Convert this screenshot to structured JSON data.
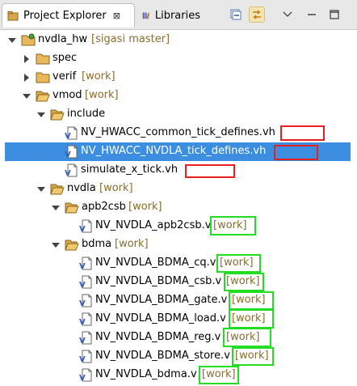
{
  "tabs": {
    "project_explorer": "Project Explorer",
    "project_explorer_close": "⊠",
    "libraries": "Libraries"
  },
  "tree": {
    "root": {
      "name": "nvdla_hw",
      "decoration": "[sigasi master]"
    },
    "spec": {
      "name": "spec"
    },
    "verif": {
      "name": "verif",
      "decoration": "[work]"
    },
    "vmod": {
      "name": "vmod",
      "decoration": "[work]"
    },
    "include": {
      "name": "include"
    },
    "include_files": [
      {
        "name": "NV_HWACC_common_tick_defines.vh"
      },
      {
        "name": "NV_HWACC_NVDLA_tick_defines.vh"
      },
      {
        "name": "simulate_x_tick.vh"
      }
    ],
    "nvdla": {
      "name": "nvdla",
      "decoration": "[work]"
    },
    "apb2csb": {
      "name": "apb2csb",
      "decoration": "[work]"
    },
    "apb2csb_files": [
      {
        "name": "NV_NVDLA_apb2csb.v",
        "decoration": "[work]"
      }
    ],
    "bdma": {
      "name": "bdma",
      "decoration": "[work]"
    },
    "bdma_files": [
      {
        "name": "NV_NVDLA_BDMA_cq.v",
        "decoration": "[work]"
      },
      {
        "name": "NV_NVDLA_BDMA_csb.v",
        "decoration": "[work]"
      },
      {
        "name": "NV_NVDLA_BDMA_gate.v",
        "decoration": "[work]"
      },
      {
        "name": "NV_NVDLA_BDMA_load.v",
        "decoration": "[work]"
      },
      {
        "name": "NV_NVDLA_BDMA_reg.v",
        "decoration": "[work]"
      },
      {
        "name": "NV_NVDLA_BDMA_store.v",
        "decoration": "[work]"
      },
      {
        "name": "NV_NVDLA_bdma.v",
        "decoration": "[work]"
      }
    ]
  },
  "colors": {
    "selection": "#3c8fe0",
    "decoration": "#8a6d2c",
    "highlight_red": "#e82020",
    "highlight_green": "#22dd22"
  }
}
